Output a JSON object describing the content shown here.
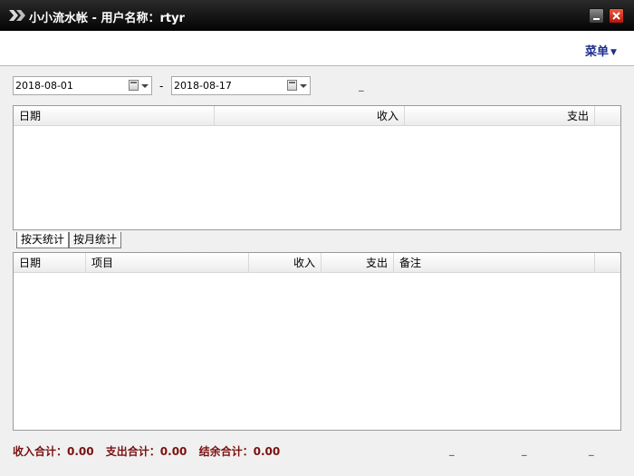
{
  "window": {
    "title": "小小流水帐 - 用户名称：rtyr",
    "icons": {
      "app": "double-chevron-icon",
      "minimize": "minimize-icon",
      "close": "close-icon"
    },
    "colors": {
      "close": "#d0301a",
      "menu": "#1d2f8c",
      "totals": "#7a1010"
    }
  },
  "menu": {
    "label": "菜单"
  },
  "filter": {
    "start_date": "2018-08-01",
    "end_date": "2018-08-17",
    "separator": "-",
    "mark": "_"
  },
  "summary_grid": {
    "columns": [
      "日期",
      "收入",
      "支出"
    ],
    "rows": []
  },
  "tabs": [
    {
      "label": "按天统计",
      "active": true
    },
    {
      "label": "按月统计",
      "active": false
    }
  ],
  "detail_grid": {
    "columns": [
      "日期",
      "项目",
      "收入",
      "支出",
      "备注"
    ],
    "rows": []
  },
  "totals": {
    "income": "收入合计：0.00",
    "expense": "支出合计：0.00",
    "balance": "结余合计：0.00"
  },
  "footer_marks": [
    "_",
    "_",
    "_"
  ]
}
